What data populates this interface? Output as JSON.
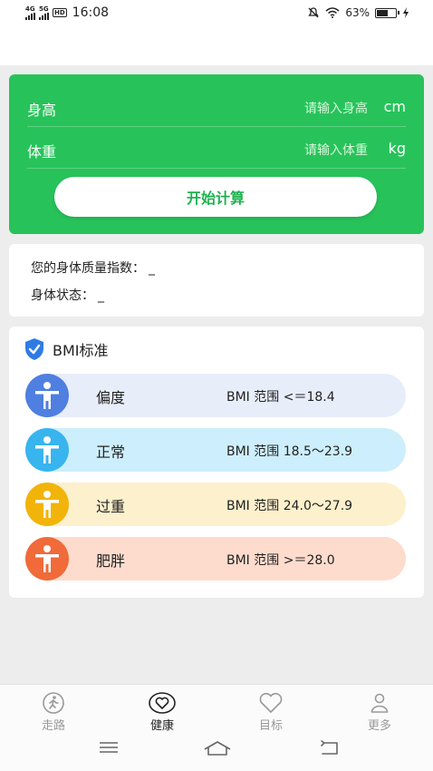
{
  "status_bar": {
    "net1": "4G",
    "net2": "5G",
    "hd": "HD",
    "time": "16:08",
    "battery_pct_text": "63%",
    "battery_level": 0.63
  },
  "form": {
    "height_label": "身高",
    "height_placeholder": "请输入身高",
    "height_unit": "cm",
    "weight_label": "体重",
    "weight_placeholder": "请输入体重",
    "weight_unit": "kg",
    "calc_button": "开始计算"
  },
  "result": {
    "bmi_label": "您的身体质量指数：",
    "bmi_value": "_",
    "status_label": "身体状态：",
    "status_value": "_"
  },
  "standard": {
    "title": "BMI标准",
    "rows": [
      {
        "name": "偏度",
        "range": "BMI 范围 <＝18.4",
        "color": "#4f7fe0",
        "bg": "#e7edf9"
      },
      {
        "name": "正常",
        "range": "BMI 范围 18.5～23.9",
        "color": "#38b4ee",
        "bg": "#cdeefc"
      },
      {
        "name": "过重",
        "range": "BMI 范围 24.0～27.9",
        "color": "#f2b40a",
        "bg": "#fdf0cc"
      },
      {
        "name": "肥胖",
        "range": "BMI 范围 >＝28.0",
        "color": "#f06a3a",
        "bg": "#fddccd"
      }
    ]
  },
  "nav": {
    "items": [
      {
        "label": "走路"
      },
      {
        "label": "健康"
      },
      {
        "label": "目标"
      },
      {
        "label": "更多"
      }
    ]
  }
}
